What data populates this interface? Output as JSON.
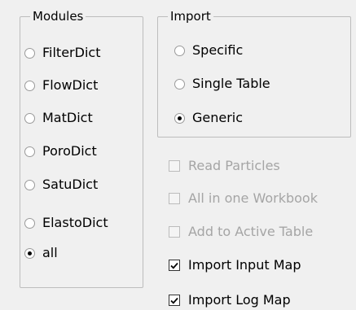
{
  "modules": {
    "legend": "Modules",
    "options": [
      {
        "label": "FilterDict",
        "checked": false
      },
      {
        "label": "FlowDict",
        "checked": false
      },
      {
        "label": "MatDict",
        "checked": false
      },
      {
        "label": "PoroDict",
        "checked": false
      },
      {
        "label": "SatuDict",
        "checked": false
      },
      {
        "label": "ElastoDict",
        "checked": false
      },
      {
        "label": "all",
        "checked": true
      }
    ]
  },
  "import": {
    "legend": "Import",
    "options": [
      {
        "label": "Specific",
        "checked": false
      },
      {
        "label": "Single Table",
        "checked": false
      },
      {
        "label": "Generic",
        "checked": true
      }
    ]
  },
  "checkboxes": [
    {
      "label": "Read Particles",
      "checked": false,
      "enabled": false
    },
    {
      "label": "All in one Workbook",
      "checked": false,
      "enabled": false
    },
    {
      "label": "Add to Active Table",
      "checked": false,
      "enabled": false
    },
    {
      "label": "Import Input Map",
      "checked": true,
      "enabled": true
    },
    {
      "label": "Import Log Map",
      "checked": true,
      "enabled": true
    }
  ]
}
